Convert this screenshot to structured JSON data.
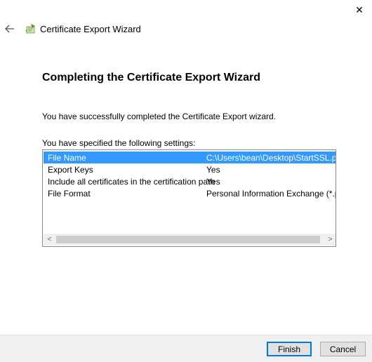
{
  "window": {
    "title": "Certificate Export Wizard",
    "close_glyph": "✕"
  },
  "page": {
    "heading": "Completing the Certificate Export Wizard",
    "message": "You have successfully completed the Certificate Export wizard.",
    "settings_label": "You have specified the following settings:"
  },
  "settings": {
    "rows": [
      {
        "key": "File Name",
        "value": "C:\\Users\\bean\\Desktop\\StartSSL.pfx",
        "selected": true
      },
      {
        "key": "Export Keys",
        "value": "Yes",
        "selected": false
      },
      {
        "key": "Include all certificates in the certification path",
        "value": "Yes",
        "selected": false
      },
      {
        "key": "File Format",
        "value": "Personal Information Exchange (*.pfx)",
        "selected": false
      }
    ],
    "scroll_left_glyph": "<",
    "scroll_right_glyph": ">"
  },
  "buttons": {
    "finish": "Finish",
    "cancel": "Cancel"
  },
  "icons": {
    "back": "back-arrow-icon",
    "app": "certificate-wizard-icon",
    "close": "close-icon"
  },
  "colors": {
    "selection": "#3399ff",
    "footer": "#f0f0f0",
    "default_button_border": "#0078d7"
  }
}
